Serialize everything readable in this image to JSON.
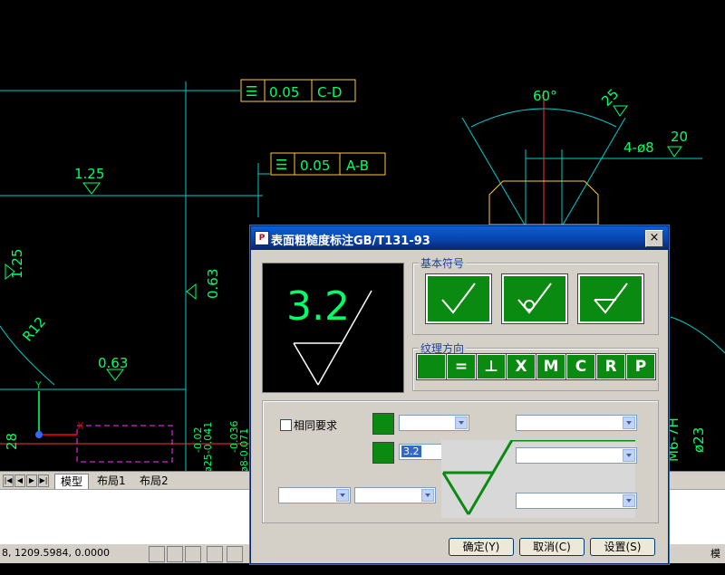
{
  "drawing": {
    "fcf1": {
      "symbol": "flatness",
      "value": "0.05",
      "datum": "C-D"
    },
    "fcf2": {
      "symbol": "flatness",
      "value": "0.05",
      "datum": "A-B"
    },
    "rough_labels": [
      "1.25",
      "0.63",
      "1.25",
      "0.63"
    ],
    "angle_label": "60°",
    "chamfer_label": "25",
    "holes_label": "4-ø8",
    "rough20": "20",
    "radius_label": "R12",
    "dim_28": "28",
    "tol_upper1": "-0.02",
    "tol_lower1": "ø25-0.041",
    "tol_upper2": "-0.036",
    "tol_lower2": "ø8-0.071",
    "mo_label": "M6-7H",
    "dim_23": "ø23",
    "axis_y": "Y",
    "axis_x": "X"
  },
  "layout_tabs": [
    "模型",
    "布局1",
    "布局2"
  ],
  "status": {
    "coords": "8, 1209.5984, 0.0000",
    "right_text": "模型"
  },
  "dialog": {
    "title": "表面粗糙度标注GB/T131-93",
    "close_label": "×",
    "preview_value": "3.2",
    "basic_symbol_label": "基本符号",
    "texture_label": "纹理方向",
    "texture_buttons": [
      "",
      "=",
      "⊥",
      "X",
      "M",
      "C",
      "R",
      "P"
    ],
    "same_req_label": "相同要求",
    "roughness_value": "3.2",
    "ok_label": "确定(Y)",
    "cancel_label": "取消(C)",
    "settings_label": "设置(S)"
  }
}
